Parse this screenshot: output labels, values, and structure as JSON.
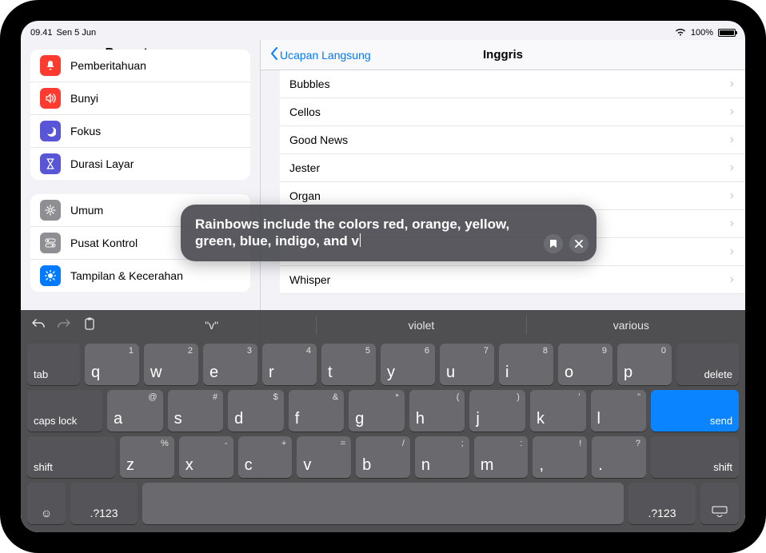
{
  "statusbar": {
    "time": "09.41",
    "date": "Sen 5 Jun",
    "battery_pct": "100%"
  },
  "sidebar": {
    "title": "Pengaturan",
    "group1": [
      {
        "label": "Pemberitahuan",
        "icon": "bell-icon",
        "color": "bg-red"
      },
      {
        "label": "Bunyi",
        "icon": "speaker-icon",
        "color": "bg-red"
      },
      {
        "label": "Fokus",
        "icon": "moon-icon",
        "color": "bg-indigo"
      },
      {
        "label": "Durasi Layar",
        "icon": "hourglass-icon",
        "color": "bg-indigo"
      }
    ],
    "group2": [
      {
        "label": "Umum",
        "icon": "gear-icon",
        "color": "bg-gray"
      },
      {
        "label": "Pusat Kontrol",
        "icon": "switches-icon",
        "color": "bg-gray"
      },
      {
        "label": "Tampilan & Kecerahan",
        "icon": "brightness-icon",
        "color": "bg-blue"
      }
    ]
  },
  "content": {
    "back_label": "Ucapan Langsung",
    "title": "Inggris",
    "voices": [
      "Bubbles",
      "Cellos",
      "Good News",
      "Jester",
      "Organ",
      "",
      "",
      "Whisper"
    ]
  },
  "speech": {
    "text": "Rainbows include the colors red, orange, yellow, green, blue, indigo, and v"
  },
  "keyboard": {
    "suggestions": [
      "\"v\"",
      "violet",
      "various"
    ],
    "row1": [
      {
        "m": "q",
        "a": "1"
      },
      {
        "m": "w",
        "a": "2"
      },
      {
        "m": "e",
        "a": "3"
      },
      {
        "m": "r",
        "a": "4"
      },
      {
        "m": "t",
        "a": "5"
      },
      {
        "m": "y",
        "a": "6"
      },
      {
        "m": "u",
        "a": "7"
      },
      {
        "m": "i",
        "a": "8"
      },
      {
        "m": "o",
        "a": "9"
      },
      {
        "m": "p",
        "a": "0"
      }
    ],
    "row2": [
      {
        "m": "a",
        "a": "@"
      },
      {
        "m": "s",
        "a": "#"
      },
      {
        "m": "d",
        "a": "$"
      },
      {
        "m": "f",
        "a": "&"
      },
      {
        "m": "g",
        "a": "*"
      },
      {
        "m": "h",
        "a": "("
      },
      {
        "m": "j",
        "a": ")"
      },
      {
        "m": "k",
        "a": "'"
      },
      {
        "m": "l",
        "a": "\""
      }
    ],
    "row3": [
      {
        "m": "z",
        "a": "%"
      },
      {
        "m": "x",
        "a": "-"
      },
      {
        "m": "c",
        "a": "+"
      },
      {
        "m": "v",
        "a": "="
      },
      {
        "m": "b",
        "a": "/"
      },
      {
        "m": "n",
        "a": ";"
      },
      {
        "m": "m",
        "a": ":"
      },
      {
        "m": ",",
        "a": "!"
      },
      {
        "m": ".",
        "a": "?"
      }
    ],
    "labels": {
      "tab": "tab",
      "delete": "delete",
      "caps": "caps lock",
      "send": "send",
      "shift": "shift",
      "num": ".?123"
    }
  }
}
